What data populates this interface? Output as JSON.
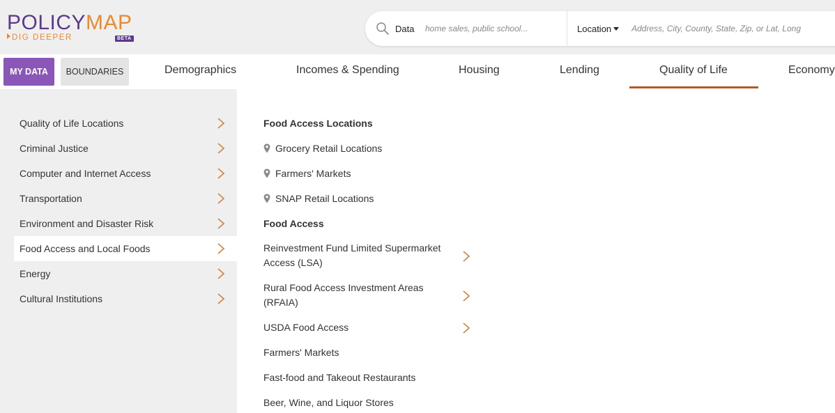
{
  "header": {
    "logo": {
      "part1": "POLICY",
      "part2": "MAP",
      "tagline": "DIG DEEPER",
      "badge": "BETA"
    },
    "search": {
      "data_label": "Data",
      "data_placeholder": "home sales, public school...",
      "location_label": "Location",
      "location_placeholder": "Address, City, County, State, Zip, or Lat, Long"
    }
  },
  "nav": {
    "my_data": "MY DATA",
    "boundaries": "BOUNDARIES",
    "tabs": [
      {
        "label": "Demographics"
      },
      {
        "label": "Incomes & Spending"
      },
      {
        "label": "Housing"
      },
      {
        "label": "Lending"
      },
      {
        "label": "Quality of Life"
      },
      {
        "label": "Economy"
      }
    ],
    "active_tab": "Quality of Life"
  },
  "sidebar": {
    "items": [
      {
        "label": "Quality of Life Locations"
      },
      {
        "label": "Criminal Justice"
      },
      {
        "label": "Computer and Internet Access"
      },
      {
        "label": "Transportation"
      },
      {
        "label": "Environment and Disaster Risk"
      },
      {
        "label": "Food Access and Local Foods"
      },
      {
        "label": "Energy"
      },
      {
        "label": "Cultural Institutions"
      }
    ],
    "active_item": "Food Access and Local Foods"
  },
  "submenu": {
    "locations_heading": "Food Access Locations",
    "locations": [
      {
        "label": "Grocery Retail Locations"
      },
      {
        "label": "Farmers' Markets"
      },
      {
        "label": "SNAP Retail Locations"
      }
    ],
    "indicators_heading": "Food Access",
    "indicators": [
      {
        "label": "Reinvestment Fund Limited Supermarket Access (LSA)",
        "has_children": true
      },
      {
        "label": "Rural Food Access Investment Areas (RFAIA)",
        "has_children": true
      },
      {
        "label": "USDA Food Access",
        "has_children": true
      },
      {
        "label": "Farmers' Markets",
        "has_children": false
      },
      {
        "label": "Fast-food and Takeout Restaurants",
        "has_children": false
      },
      {
        "label": "Beer, Wine, and Liquor Stores",
        "has_children": false
      }
    ]
  },
  "colors": {
    "brand_purple": "#5d3a89",
    "brand_orange": "#ea8a2f",
    "my_data_bg": "#8a56b8",
    "active_underline": "#b45a1f",
    "chevron": "#d08a4e"
  },
  "icons": [
    "search-icon",
    "caret-down-icon",
    "chevron-right-icon",
    "map-pin-icon"
  ]
}
